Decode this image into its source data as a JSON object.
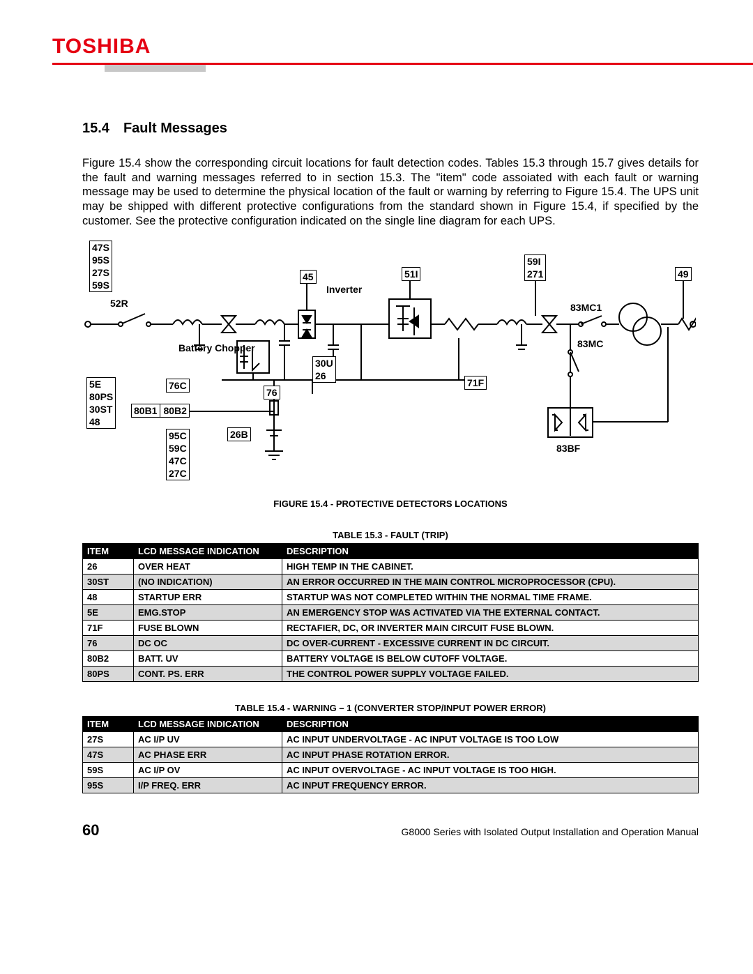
{
  "brand": "TOSHIBA",
  "section_number": "15.4",
  "section_title": "Fault Messages",
  "body_paragraph": "Figure 15.4 show the corresponding circuit locations for fault detection codes. Tables 15.3 through 15.7 gives details for the fault and warning messages referred to in section 15.3.  The \"item\" code assoiated with each fault or warning message may be used to determine the physical location of the fault or warning by referring to Figure 15.4. The UPS unit may be shipped with different protective configurations from the standard shown in Figure 15.4, if specified by the customer. See the protective configuration indicated on the single line diagram for each UPS.",
  "figure": {
    "caption": "FIGURE 15.4 - PROTECTIVE DETECTORS LOCATIONS",
    "labels": {
      "box_47S_stack": [
        "47S",
        "95S",
        "27S",
        "59S"
      ],
      "label_52R": "52R",
      "box_45": "45",
      "label_inverter": "Inverter",
      "box_51I": "51I",
      "box_59I_stack": [
        "59I",
        "271"
      ],
      "box_49": "49",
      "label_83MC1": "83MC1",
      "label_83MC": "83MC",
      "label_battery_chopper": "Battery Chopper",
      "box_76C": "76C",
      "box_76": "76",
      "box_30U_stack": [
        "30U",
        "26"
      ],
      "box_71F": "71F",
      "box_5E_stack": [
        "5E",
        "80PS",
        "30ST",
        "48"
      ],
      "box_80B1": "80B1",
      "box_80B2": "80B2",
      "box_26B": "26B",
      "box_95C_stack": [
        "95C",
        "59C",
        "47C",
        "27C"
      ],
      "label_83BF": "83BF"
    }
  },
  "table1": {
    "caption": "TABLE 15.3 - FAULT (TRIP)",
    "headers": [
      "ITEM",
      "LCD MESSAGE INDICATION",
      "DESCRIPTION"
    ],
    "rows": [
      {
        "item": "26",
        "msg": "Over Heat",
        "desc": "High temp in the cabinet."
      },
      {
        "item": "30ST",
        "msg": "(No indication)",
        "desc": "An error occurred in the main control microprocessor (CPU)."
      },
      {
        "item": "48",
        "msg": "Startup Err",
        "desc": "Startup was not completed within the normal time frame."
      },
      {
        "item": "5E",
        "msg": "Emg.Stop",
        "desc": "An emergency stop was activated via the external contact."
      },
      {
        "item": "71F",
        "msg": "Fuse Blown",
        "desc": "Rectafier, DC, or inverter main circuit fuse blown."
      },
      {
        "item": "76",
        "msg": "DC OC",
        "desc": "DC over-current - excessive current in DC circuit."
      },
      {
        "item": "80B2",
        "msg": "Batt. UV",
        "desc": "Battery voltage is below cutoff voltage."
      },
      {
        "item": "80PS",
        "msg": "Cont. PS. Err",
        "desc": "The control power supply voltage failed."
      }
    ]
  },
  "table2": {
    "caption": "TABLE 15.4 - WARNING – 1 (CONVERTER STOP/INPUT POWER ERROR)",
    "headers": [
      "ITEM",
      "LCD MESSAGE INDICATION",
      "DESCRIPTION"
    ],
    "rows": [
      {
        "item": "27S",
        "msg": "AC I/P UV",
        "desc": "AC input undervoltage - AC input voltage is too low"
      },
      {
        "item": "47S",
        "msg": "AC Phase Err",
        "desc": "AC input phase rotation error."
      },
      {
        "item": "59S",
        "msg": "AC I/P OV",
        "desc": "AC input overvoltage - AC input voltage is too high."
      },
      {
        "item": "95S",
        "msg": "I/P Freq. Err",
        "desc": "AC input frequency error."
      }
    ]
  },
  "footer": {
    "page_number": "60",
    "title": "G8000 Series with Isolated Output Installation and Operation Manual"
  }
}
